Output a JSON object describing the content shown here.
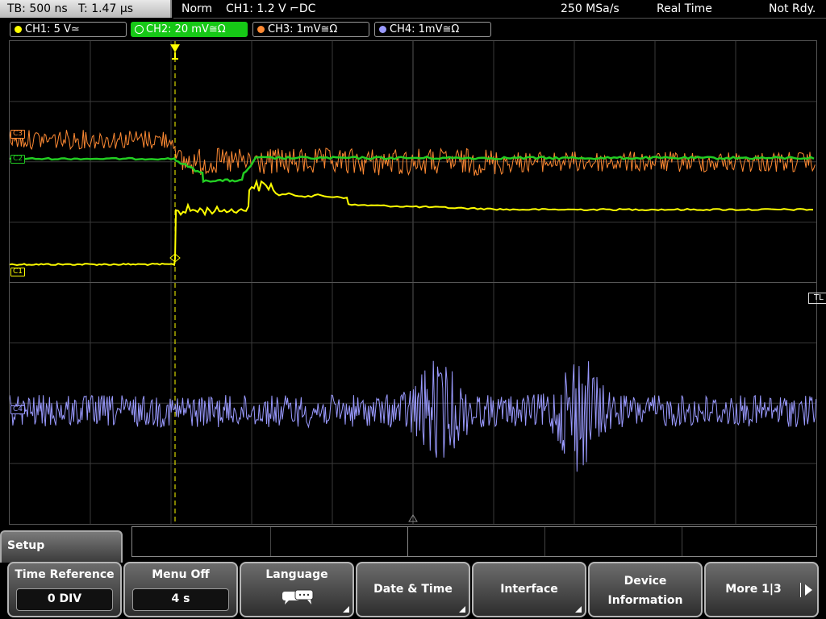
{
  "topbar": {
    "timebase": "TB: 500 ns   T: 1.47 µs",
    "mode": "Norm",
    "trigger": "CH1: 1.2 V ⌐DC",
    "sample_rate": "250 MSa/s",
    "acq_mode": "Real Time",
    "status": "Not Rdy."
  },
  "channels": [
    {
      "label": "CH1: 5 V≃",
      "color": "#ffff00",
      "active": false
    },
    {
      "label": "CH2: 20 mV≅Ω",
      "color": "#22cc22",
      "active": true
    },
    {
      "label": "CH3: 1mV≅Ω",
      "color": "#ff8a33",
      "active": false
    },
    {
      "label": "CH4: 1mV≅Ω",
      "color": "#9a9aff",
      "active": false
    }
  ],
  "markers": {
    "c1": "C1",
    "c2": "C2",
    "c3": "C3",
    "c4": "C4",
    "trigger_level": "TL"
  },
  "menu": {
    "title": "Setup",
    "keys": [
      {
        "label": "Time Reference",
        "value": "0 DIV"
      },
      {
        "label": "Menu Off",
        "value": "4 s"
      },
      {
        "label": "Language"
      },
      {
        "label": "Date & Time"
      },
      {
        "label": "Interface"
      },
      {
        "label": "Device",
        "label2": "Information"
      },
      {
        "label": "More 1|3"
      }
    ]
  },
  "colors": {
    "ch1": "#ffff00",
    "ch2": "#22cc22",
    "ch3": "#ff8a33",
    "ch4": "#9a9aff",
    "grid": "#3a3a3a"
  }
}
